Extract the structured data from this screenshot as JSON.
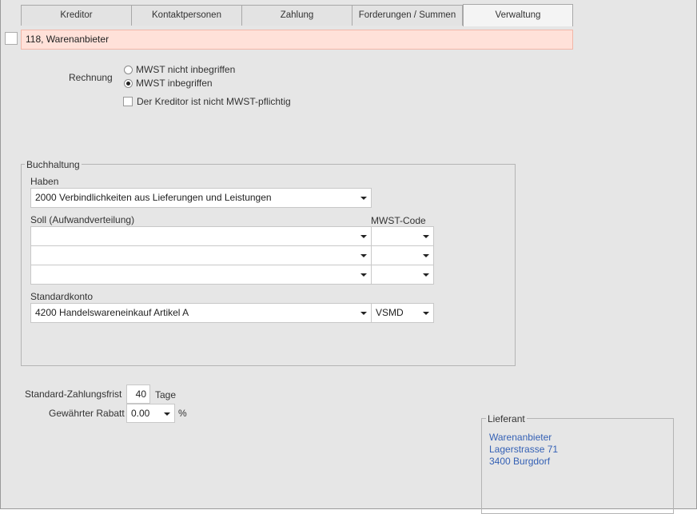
{
  "tabs": [
    {
      "label": "Kreditor"
    },
    {
      "label": "Kontaktpersonen"
    },
    {
      "label": "Zahlung"
    },
    {
      "label": "Forderungen / Summen"
    },
    {
      "label": "Verwaltung"
    }
  ],
  "record": {
    "title": "118, Warenanbieter"
  },
  "rechnung": {
    "label": "Rechnung",
    "option_excl": "MWST nicht  inbegriffen",
    "option_incl": "MWST inbegriffen",
    "not_vat_label": "Der Kreditor ist nicht MWST-pflichtig"
  },
  "buchhaltung": {
    "title": "Buchhaltung",
    "haben_label": "Haben",
    "haben_value": "2000 Verbindlichkeiten aus Lieferungen und Leistungen",
    "soll_label": "Soll (Aufwandverteilung)",
    "mwst_code_label": "MWST-Code",
    "standardkonto_label": "Standardkonto",
    "standardkonto_value": "4200 Handelswareneinkauf Artikel A",
    "standard_mwst_code": "VSMD"
  },
  "zahlung": {
    "frist_label": "Standard-Zahlungsfrist",
    "frist_value": "40",
    "frist_unit": "Tage",
    "rabatt_label": "Gewährter Rabatt",
    "rabatt_value": "0.00",
    "rabatt_unit": "%"
  },
  "lieferant": {
    "title": "Lieferant",
    "name": "Warenanbieter",
    "street": "Lagerstrasse 71",
    "city": "3400 Burgdorf"
  }
}
